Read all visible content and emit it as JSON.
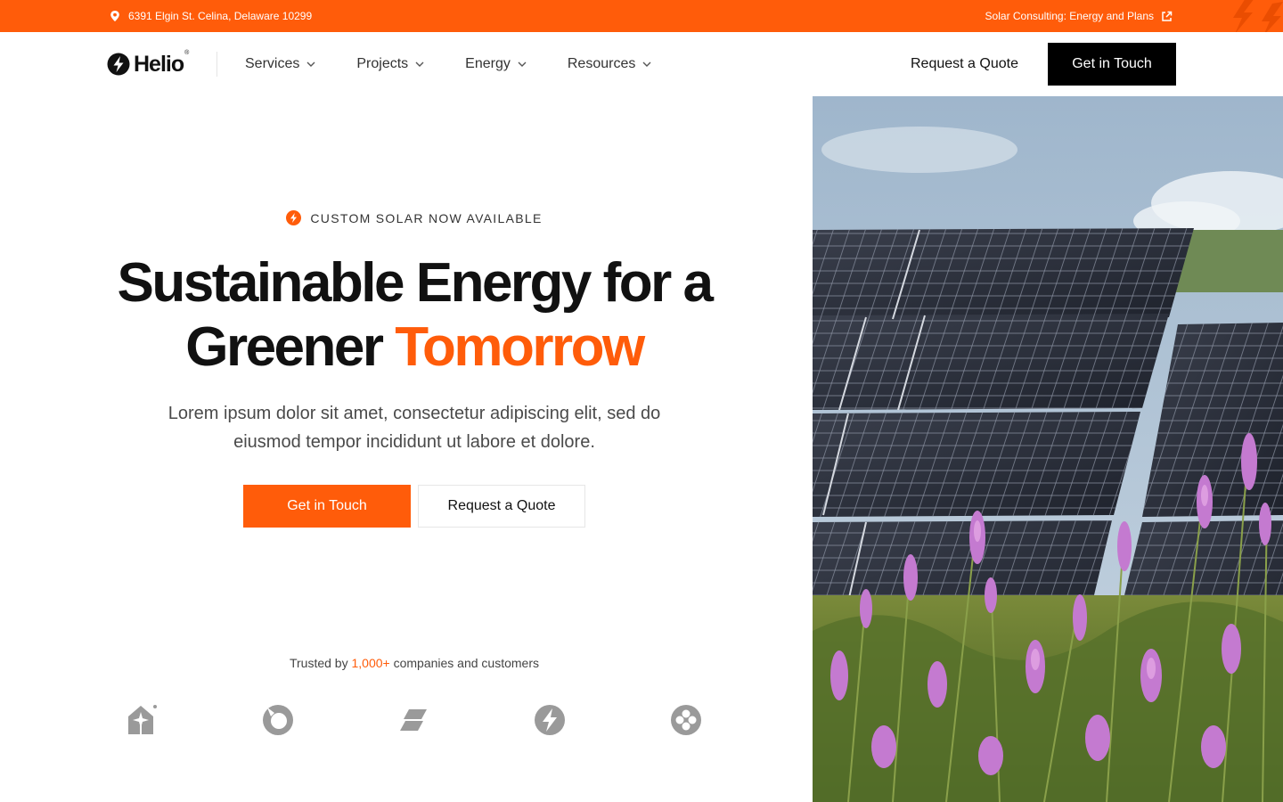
{
  "topbar": {
    "address": "6391 Elgin St. Celina, Delaware 10299",
    "promo_link": "Solar Consulting: Energy and Plans",
    "background_color": "#FF5C0A",
    "icons": [
      "location-pin-icon",
      "external-link-icon"
    ]
  },
  "nav": {
    "logo_text": "Helio",
    "logo_mark": "®",
    "menu": [
      {
        "label": "Services"
      },
      {
        "label": "Projects"
      },
      {
        "label": "Energy"
      },
      {
        "label": "Resources"
      }
    ],
    "quote_link": "Request a Quote",
    "cta_button": "Get in Touch"
  },
  "hero": {
    "eyebrow": "CUSTOM SOLAR NOW AVAILABLE",
    "headline_line1": "Sustainable Energy for a",
    "headline_line2_plain": "Greener",
    "headline_line2_accent": "Tomorrow",
    "description": "Lorem ipsum dolor sit amet, consectetur adipiscing elit, sed do eiusmod tempor incididunt ut labore et dolore.",
    "primary_button": "Get in Touch",
    "secondary_button": "Request a Quote",
    "trusted_prefix": "Trusted by",
    "trusted_count": "1,000+",
    "trusted_suffix": "companies and customers",
    "partner_logos": [
      "house-star-logo",
      "ring-logo",
      "slash-logo",
      "bolt-logo",
      "clover-logo"
    ]
  },
  "colors": {
    "accent": "#FF5C0A",
    "text": "#111111",
    "muted": "#4a4a4a",
    "logo_gray": "#9a9a9a"
  }
}
